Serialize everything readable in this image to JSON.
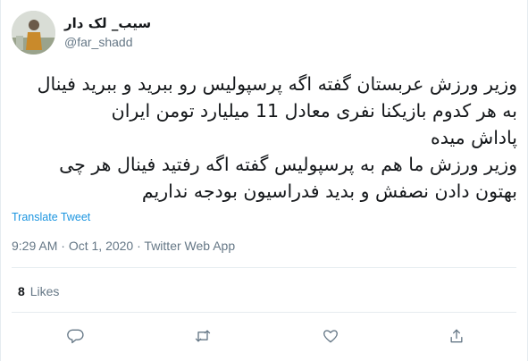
{
  "tweet": {
    "author": {
      "display_name": "سیب_ لک دار",
      "handle": "@far_shadd"
    },
    "text_lines": [
      "وزیر ورزش عربستان گفته اگه پرسپولیس رو ببرید و ببرید فینال",
      "به هر کدوم بازیکنا نفری معادل 11 میلیارد تومن ایران",
      "پاداش میده",
      "وزیر ورزش ما هم  به پرسپولیس گفته اگه رفتید فینال هر چی",
      "بهتون دادن نصفش و بدید فدراسیون  بودجه نداریم"
    ],
    "translate_label": "Translate Tweet",
    "meta": {
      "time": "9:29 AM",
      "date": "Oct 1, 2020",
      "source": "Twitter Web App",
      "separator": " · "
    },
    "likes": {
      "count": "8",
      "label": "Likes"
    }
  },
  "actions": [
    {
      "name": "reply",
      "icon": "reply-icon"
    },
    {
      "name": "retweet",
      "icon": "retweet-icon"
    },
    {
      "name": "like",
      "icon": "heart-icon"
    },
    {
      "name": "share",
      "icon": "share-icon"
    }
  ],
  "colors": {
    "text": "#14171a",
    "secondary": "#657786",
    "link": "#1b95e0",
    "divider": "#e6ecf0"
  }
}
